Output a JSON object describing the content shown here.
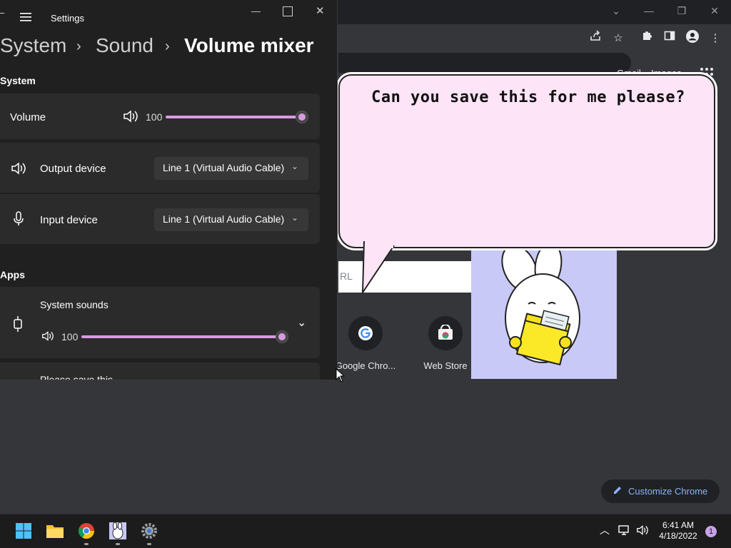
{
  "chrome": {
    "links": {
      "gmail": "Gmail",
      "images": "Images"
    },
    "search_placeholder": "RL",
    "shortcuts": [
      {
        "label": "Google Chro..."
      },
      {
        "label": "Web Store"
      }
    ],
    "customize_label": "Customize Chrome"
  },
  "bubble": {
    "text": "Can you save this for me please?"
  },
  "settings": {
    "title": "Settings",
    "breadcrumb": [
      "System",
      "Sound",
      "Volume mixer"
    ],
    "system_section": "System",
    "volume": {
      "label": "Volume",
      "value": "100",
      "level_percent": 100
    },
    "output": {
      "label": "Output device",
      "value": "Line 1 (Virtual Audio Cable)"
    },
    "input": {
      "label": "Input device",
      "value": "Line 1 (Virtual Audio Cable)"
    },
    "apps_section": "Apps",
    "system_sounds": {
      "label": "System sounds",
      "value": "100",
      "level_percent": 100
    },
    "next_app": {
      "label": "Please save this"
    }
  },
  "taskbar": {
    "time": "6:41 AM",
    "date": "4/18/2022",
    "notification_count": "1"
  },
  "colors": {
    "accent": "#d99ae3",
    "bubble_bg": "#fde4f6",
    "chrome_link": "#8ab4f8"
  }
}
